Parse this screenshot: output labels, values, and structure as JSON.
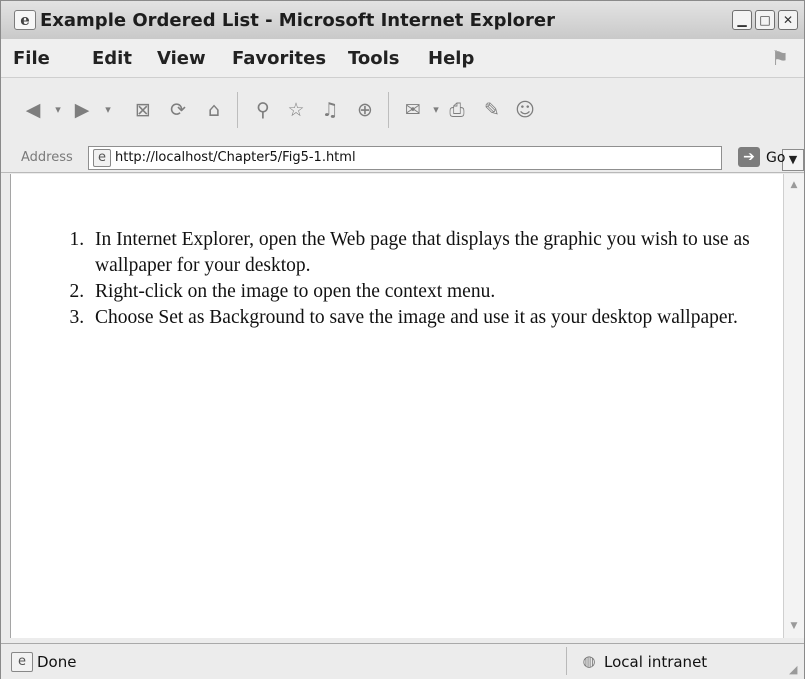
{
  "window": {
    "title": "Example Ordered List - Microsoft Internet Explorer"
  },
  "menu": [
    "File",
    "Edit",
    "View",
    "Favorites",
    "Tools",
    "Help"
  ],
  "toolbar": {
    "icons": [
      "back-icon",
      "back-dropdown-icon",
      "forward-icon",
      "forward-dropdown-icon",
      "stop-icon",
      "refresh-icon",
      "home-icon",
      "search-icon",
      "favorites-icon",
      "media-icon",
      "history-icon",
      "mail-icon",
      "mail-dropdown-icon",
      "print-icon",
      "edit-icon",
      "messenger-icon"
    ]
  },
  "address": {
    "label": "Address",
    "url": "http://localhost/Chapter5/Fig5-1.html",
    "go_label": "Go"
  },
  "content": {
    "list_items": [
      "In Internet Explorer, open the Web page that displays the graphic you wish to use as wallpaper for your desktop.",
      "Right-click on the image to open the context menu.",
      "Choose Set as Background to save the image and use it as your desktop wallpaper."
    ]
  },
  "status": {
    "text": "Done",
    "zone": "Local intranet"
  }
}
